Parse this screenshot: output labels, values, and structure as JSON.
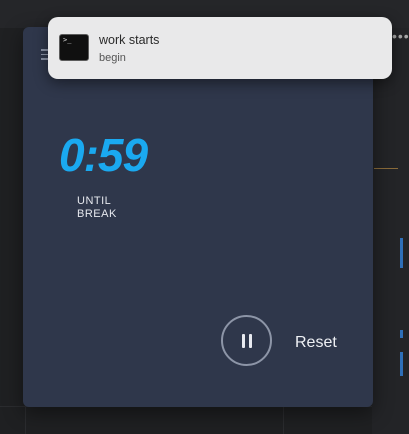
{
  "notification": {
    "title": "work starts",
    "body": "begin",
    "app_icon": "terminal-icon",
    "prompt_glyph": ">_"
  },
  "timer": {
    "time_remaining": "0:59",
    "status_label": "UNTIL BREAK",
    "pause_icon": "pause-icon",
    "reset_label": "Reset",
    "menu_icon": "hamburger-menu-icon"
  },
  "background": {
    "overflow_menu": "•••"
  },
  "colors": {
    "timer_accent": "#1aa9f0",
    "card_background": "#2f374b",
    "notification_background": "#e9e9ea"
  }
}
